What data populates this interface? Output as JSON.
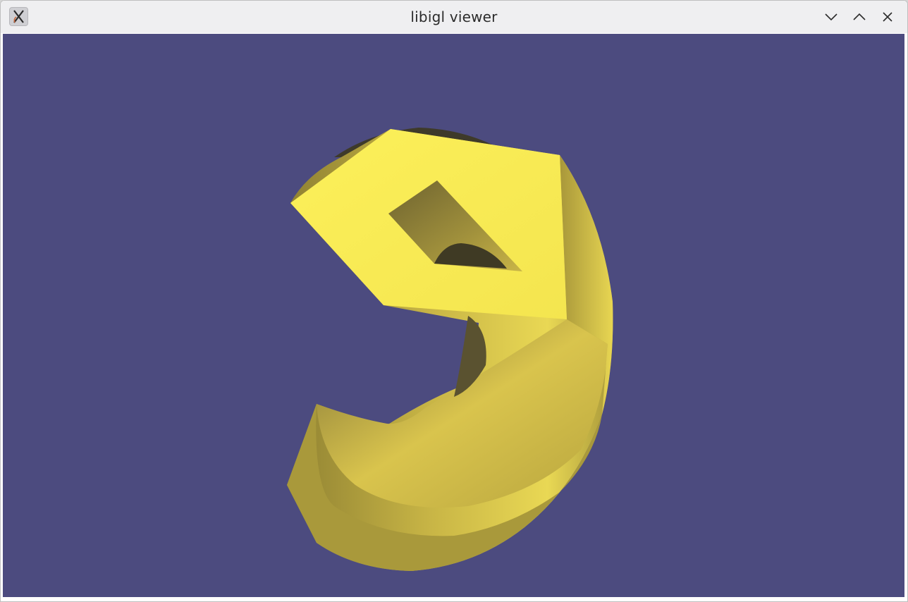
{
  "window": {
    "title": "libigl viewer",
    "app_icon": "x-window-icon",
    "controls": {
      "minimize_icon": "chevron-down-icon",
      "maximize_icon": "chevron-up-icon",
      "close_icon": "close-icon"
    }
  },
  "viewport": {
    "background_color": "#4c4b7f",
    "mesh_color": "#f2e34f",
    "content": "3d-mesh-render"
  }
}
